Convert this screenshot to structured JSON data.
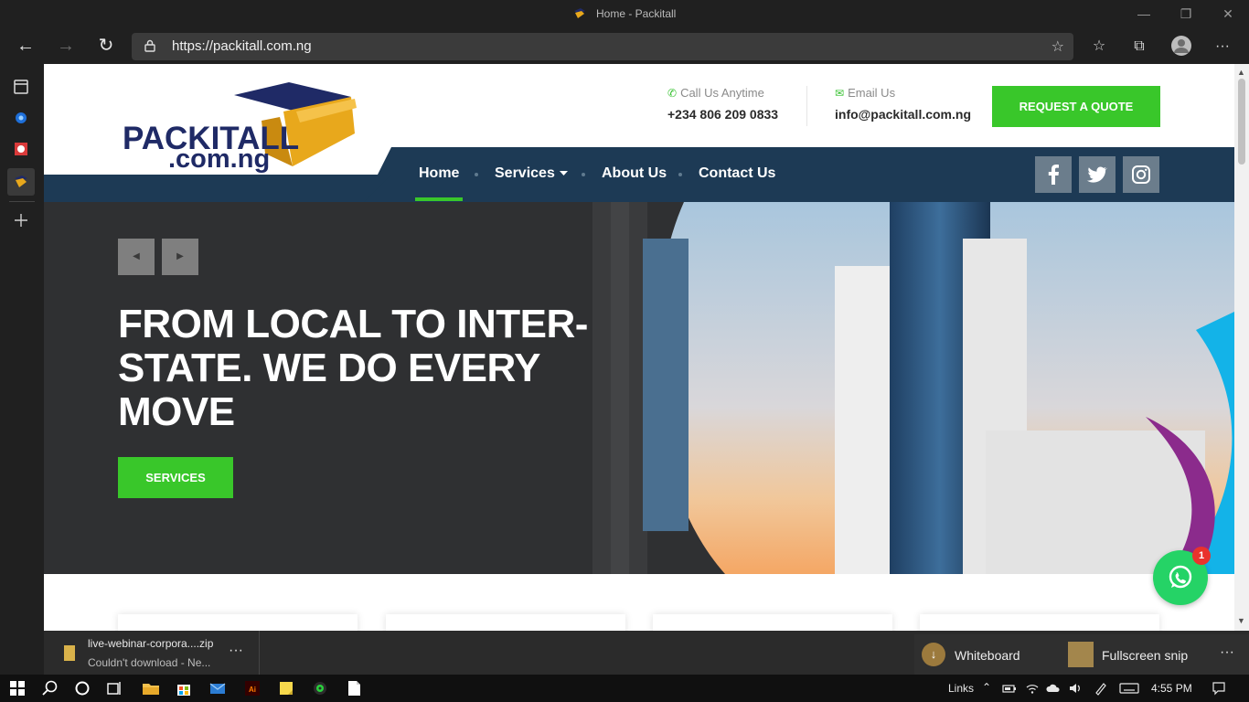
{
  "window": {
    "title": "Home - Packitall",
    "controls": {
      "minimize": "—",
      "restore": "❐",
      "close": "✕"
    }
  },
  "toolbar": {
    "back": "←",
    "forward": "→",
    "refresh": "↻",
    "url": "https://packitall.com.ng",
    "add_favorite_icon": "☆",
    "favorites_icon": "☆",
    "collections_icon": "⧉",
    "menu_icon": "···"
  },
  "site": {
    "logo": {
      "line1": "PACKITALL",
      "line2": ".com.ng"
    },
    "contact": {
      "phone_label": "Call Us Anytime",
      "phone": "+234 806 209 0833",
      "email_label": "Email Us",
      "email": "info@packitall.com.ng"
    },
    "quote_button": "REQUEST A QUOTE",
    "nav": {
      "home": "Home",
      "services": "Services",
      "about": "About Us",
      "contact": "Contact Us"
    },
    "social": {
      "facebook": "f",
      "twitter": "t",
      "instagram": "ig"
    },
    "hero": {
      "prev": "◀",
      "next": "▶",
      "title": "FROM LOCAL TO INTER-STATE. WE DO EVERY MOVE",
      "button": "SERVICES"
    },
    "whatsapp_badge": "1"
  },
  "downloads": {
    "file_name": "live-webinar-corpora....zip",
    "status": "Couldn't download - Ne...",
    "more": "···"
  },
  "notifications": {
    "whiteboard": "Whiteboard",
    "snip": "Fullscreen snip",
    "more": "···"
  },
  "taskbar": {
    "links": "Links",
    "time": "4:55 PM"
  },
  "colors": {
    "accent_green": "#39c72a",
    "nav_navy": "#1d3a55",
    "logo_navy": "#1f2a66",
    "logo_gold": "#e8a81c",
    "whatsapp": "#25d366"
  }
}
